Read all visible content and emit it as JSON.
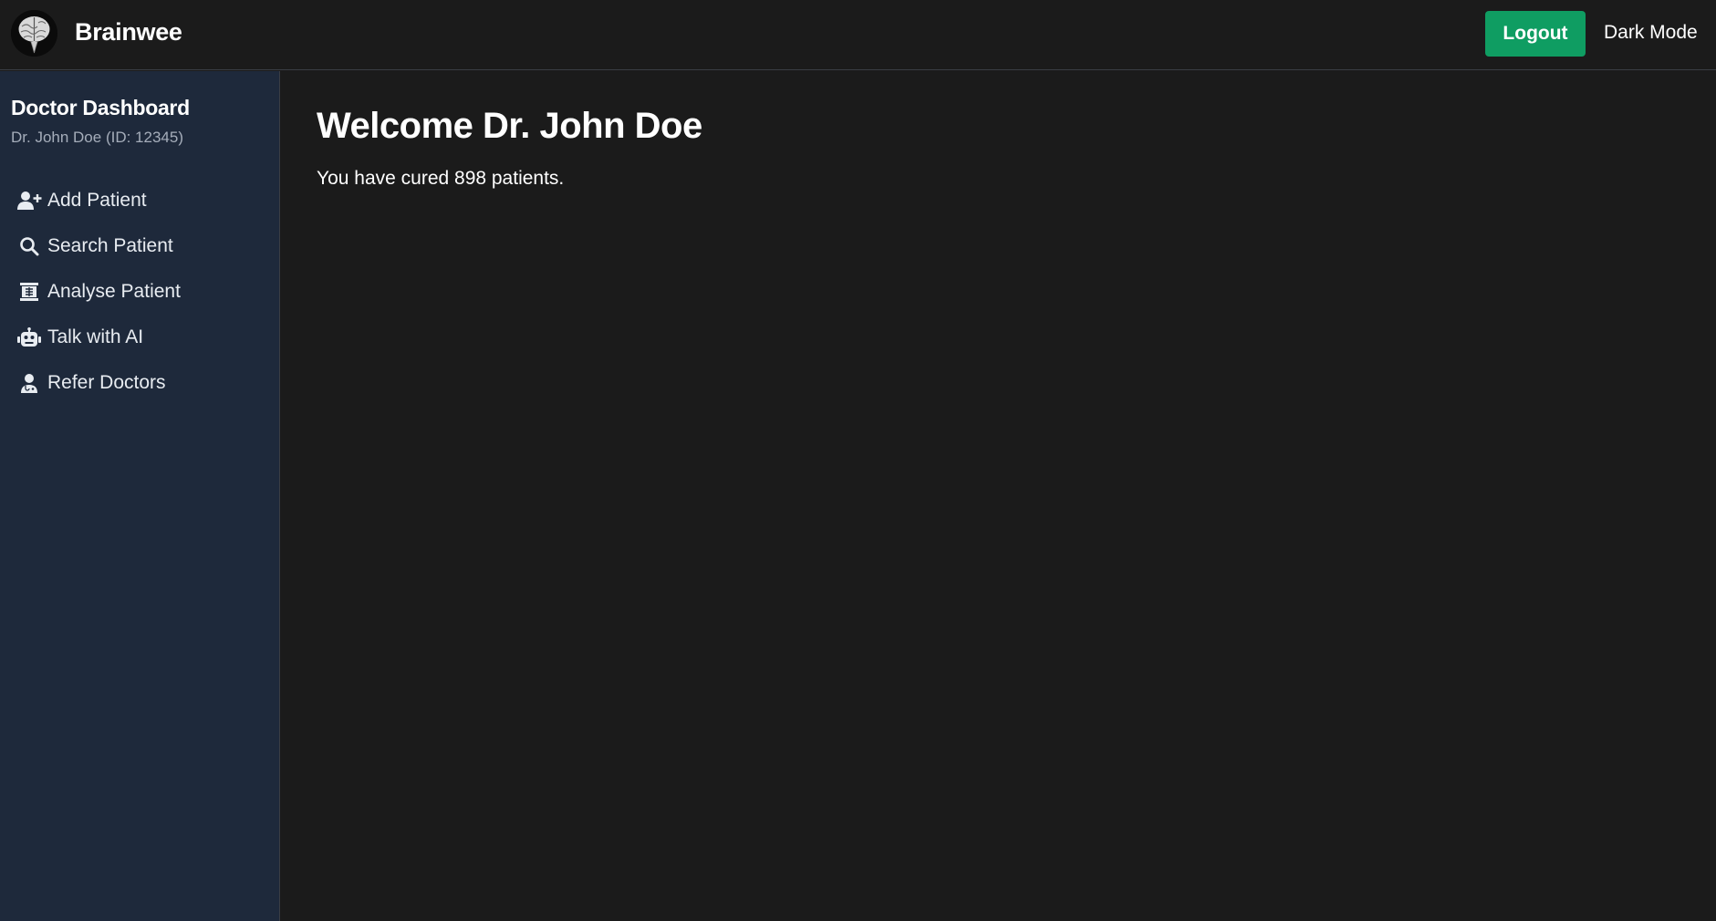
{
  "header": {
    "app_name": "Brainwee",
    "logout_label": "Logout",
    "theme_toggle_label": "Dark Mode"
  },
  "sidebar": {
    "title": "Doctor Dashboard",
    "subtitle": "Dr. John Doe (ID: 12345)",
    "items": [
      {
        "label": "Add Patient",
        "icon": "user-plus-icon"
      },
      {
        "label": "Search Patient",
        "icon": "search-icon"
      },
      {
        "label": "Analyse Patient",
        "icon": "x-ray-icon"
      },
      {
        "label": "Talk with AI",
        "icon": "robot-icon"
      },
      {
        "label": "Refer Doctors",
        "icon": "user-doctor-icon"
      }
    ]
  },
  "main": {
    "welcome_title": "Welcome Dr. John Doe",
    "message": "You have cured 898 patients."
  },
  "colors": {
    "background": "#1b1b1b",
    "sidebar": "#1e293b",
    "accent": "#0f9d62",
    "muted_text": "#a5adba"
  }
}
